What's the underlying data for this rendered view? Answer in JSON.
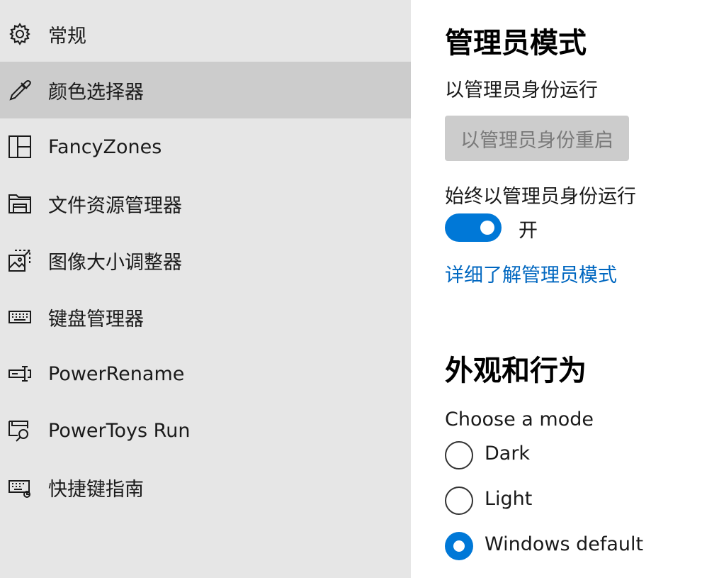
{
  "sidebar": {
    "items": [
      {
        "label": "常规",
        "icon": "gear-icon"
      },
      {
        "label": "颜色选择器",
        "icon": "color-picker-icon"
      },
      {
        "label": "FancyZones",
        "icon": "fancyzones-icon"
      },
      {
        "label": "文件资源管理器",
        "icon": "file-explorer-icon"
      },
      {
        "label": "图像大小调整器",
        "icon": "image-resizer-icon"
      },
      {
        "label": "键盘管理器",
        "icon": "keyboard-icon"
      },
      {
        "label": "PowerRename",
        "icon": "powerrename-icon"
      },
      {
        "label": "PowerToys Run",
        "icon": "powertoys-run-icon"
      },
      {
        "label": "快捷键指南",
        "icon": "shortcut-guide-icon"
      }
    ],
    "selected_index": 1
  },
  "admin": {
    "heading": "管理员模式",
    "run_as_label": "以管理员身份运行",
    "restart_button": "以管理员身份重启",
    "always_run_label": "始终以管理员身份运行",
    "toggle_state": "开",
    "toggle_on": true,
    "learn_more_link": "详细了解管理员模式"
  },
  "appearance": {
    "heading": "外观和行为",
    "mode_label": "Choose a mode",
    "options": [
      {
        "label": "Dark",
        "checked": false
      },
      {
        "label": "Light",
        "checked": false
      },
      {
        "label": "Windows default",
        "checked": true
      }
    ]
  },
  "colors": {
    "accent": "#0078d7",
    "link": "#0067c0",
    "sidebar_bg": "#e6e6e6",
    "sidebar_selected": "#cccccc"
  }
}
